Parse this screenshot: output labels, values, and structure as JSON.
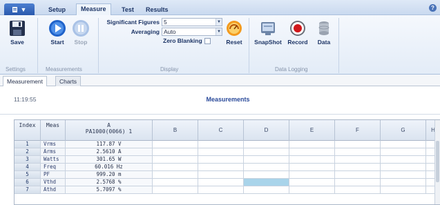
{
  "ribbon_tabs": [
    "Setup",
    "Measure",
    "Test",
    "Results"
  ],
  "app_button_label": "▼",
  "buttons": {
    "save": "Save",
    "start": "Start",
    "stop": "Stop",
    "reset": "Reset",
    "snapshot": "SnapShot",
    "record": "Record",
    "data": "Data"
  },
  "groups": {
    "settings": "Settings",
    "measurements": "Measurements",
    "display": "Display",
    "data_logging": "Data Logging"
  },
  "display": {
    "sig_figs_label": "Significant Figures",
    "sig_figs_value": "5",
    "averaging_label": "Averaging",
    "averaging_value": "Auto",
    "zero_blanking_label": "Zero Blanking"
  },
  "doc_tabs": [
    "Measurement",
    "Charts"
  ],
  "time": "11:19:55",
  "measurements_title": "Measurements",
  "grid": {
    "index_header": "Index",
    "meas_header": "Meas",
    "col_a_header_1": "A",
    "col_a_header_2": "PA1000(0066) 1",
    "letters": [
      "B",
      "C",
      "D",
      "E",
      "F",
      "G",
      "H"
    ],
    "rows": [
      {
        "index": "1",
        "meas": "Vrms",
        "value": "117.87 V"
      },
      {
        "index": "2",
        "meas": "Arms",
        "value": "2.5610 A"
      },
      {
        "index": "3",
        "meas": "Watts",
        "value": "301.65 W"
      },
      {
        "index": "4",
        "meas": "Freq",
        "value": "60.016 Hz"
      },
      {
        "index": "5",
        "meas": "PF",
        "value": "999.20 m"
      },
      {
        "index": "6",
        "meas": "Vthd",
        "value": "2.5768 %"
      },
      {
        "index": "7",
        "meas": "Athd",
        "value": "5.7097 %"
      }
    ]
  },
  "colors": {
    "accent": "#2a59ad",
    "selected_cell": "#a9d4ea"
  }
}
